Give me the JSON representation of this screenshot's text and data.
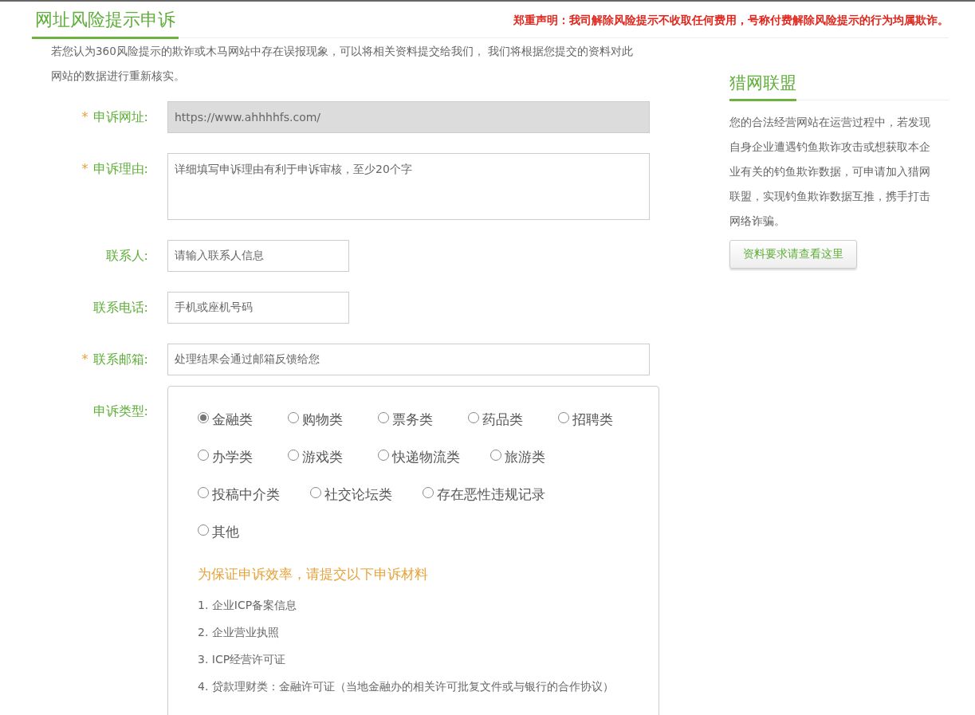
{
  "header": {
    "title": "网址风险提示申诉",
    "notice": "郑重声明：我司解除风险提示不收取任何费用，号称付费解除风险提示的行为均属欺诈。"
  },
  "intro": "若您认为360风险提示的欺诈或木马网站中存在误报现象，可以将相关资料提交给我们， 我们将根据您提交的资料对此网站的数据进行重新核实。",
  "fields": [
    {
      "kind": "input",
      "required_mark": "*",
      "label": "申诉网址:",
      "value": "https://www.ahhhhfs.com/",
      "disabled": true
    },
    {
      "kind": "textarea",
      "required_mark": "*",
      "label": "申诉理由:",
      "placeholder": "详细填写申诉理由有利于申诉审核，至少20个字",
      "disabled": false
    },
    {
      "kind": "short_input",
      "label": "联系人:",
      "placeholder": "请输入联系人信息",
      "disabled": false
    },
    {
      "kind": "short_input",
      "label": "联系电话:",
      "placeholder": "手机或座机号码",
      "disabled": false
    },
    {
      "kind": "input",
      "required_mark": "*",
      "label": "联系邮箱:",
      "placeholder": "处理结果会通过邮箱反馈给您",
      "disabled": false
    }
  ],
  "appeal_type": {
    "label": "申诉类型:",
    "option_rows": [
      {
        "options": [
          {
            "label": "金融类",
            "selected": true
          },
          {
            "label": "购物类",
            "selected": false
          },
          {
            "label": "票务类",
            "selected": false
          },
          {
            "label": "药品类",
            "selected": false
          },
          {
            "label": "招聘类",
            "selected": false
          }
        ]
      },
      {
        "options": [
          {
            "label": "办学类",
            "selected": false
          },
          {
            "label": "游戏类",
            "selected": false
          },
          {
            "label": "快递物流类",
            "selected": false
          },
          {
            "label": "旅游类",
            "selected": false
          }
        ]
      },
      {
        "options": [
          {
            "label": "投稿中介类",
            "selected": false
          },
          {
            "label": "社交论坛类",
            "selected": false
          },
          {
            "label": "存在恶性违规记录",
            "selected": false
          }
        ]
      },
      {
        "options": [
          {
            "label": "其他",
            "selected": false
          }
        ]
      }
    ],
    "materials_heading": "为保证申诉效率，请提交以下申诉材料",
    "materials": [
      "1. 企业ICP备案信息",
      "2. 企业营业执照",
      "3. ICP经营许可证",
      "4. 贷款理财类：金融许可证（当地金融办的相关许可批复文件或与银行的合作协议）"
    ]
  },
  "sidebar": {
    "title": "猎网联盟",
    "text": "您的合法经营网站在运营过程中，若发现自身企业遭遇钓鱼欺诈攻击或想获取本企业有关的钓鱼欺诈数据，可申请加入猎网联盟，实现钓鱼欺诈数据互推，携手打击网络诈骗。",
    "button": "资料要求请查看这里"
  }
}
